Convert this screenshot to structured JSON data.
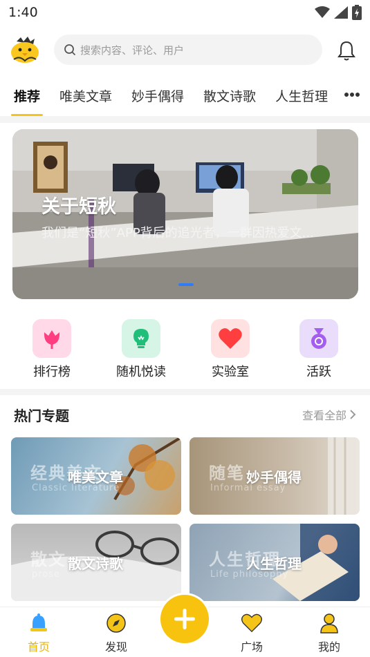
{
  "status_bar": {
    "time": "1:40"
  },
  "search": {
    "placeholder": "搜索内容、评论、用户"
  },
  "tabs": [
    {
      "label": "推荐",
      "active": true
    },
    {
      "label": "唯美文章"
    },
    {
      "label": "妙手偶得"
    },
    {
      "label": "散文诗歌"
    },
    {
      "label": "人生哲理"
    }
  ],
  "banner": {
    "title": "关于短秋",
    "subtitle": "我们是“短秋”APP背后的追光者，一群因热爱文...",
    "slide_count": 3,
    "active_slide": 2
  },
  "quick_actions": [
    {
      "label": "排行榜",
      "icon": "tulip-icon",
      "color": "#ffd9e8"
    },
    {
      "label": "随机悦读",
      "icon": "bulb-icon",
      "color": "#d6f5e6"
    },
    {
      "label": "实验室",
      "icon": "heart-icon",
      "color": "#ffe1e1"
    },
    {
      "label": "活跃",
      "icon": "medal-icon",
      "color": "#eadcfb"
    }
  ],
  "hot_topics": {
    "title": "热门专题",
    "view_all": "查看全部",
    "items": [
      {
        "label": "唯美文章",
        "bg_text": "经典美文",
        "bg_sub": "Classic literature"
      },
      {
        "label": "妙手偶得",
        "bg_text": "随笔",
        "bg_sub": "Informal essay"
      },
      {
        "label": "散文诗歌",
        "bg_text": "散文",
        "bg_sub": "prose"
      },
      {
        "label": "人生哲理",
        "bg_text": "人生哲理",
        "bg_sub": "Life philosophy"
      }
    ]
  },
  "bottom_nav": [
    {
      "label": "首页",
      "icon": "bell-home-icon",
      "active": true
    },
    {
      "label": "发现",
      "icon": "compass-icon"
    },
    {
      "label": "广场",
      "icon": "heart-square-icon"
    },
    {
      "label": "我的",
      "icon": "user-icon"
    }
  ],
  "colors": {
    "accent": "#f7c30f",
    "active_tab_underline": "#f5c419",
    "active_nav_label": "#e8b400",
    "banner_dot_active": "#2f7cf6"
  }
}
